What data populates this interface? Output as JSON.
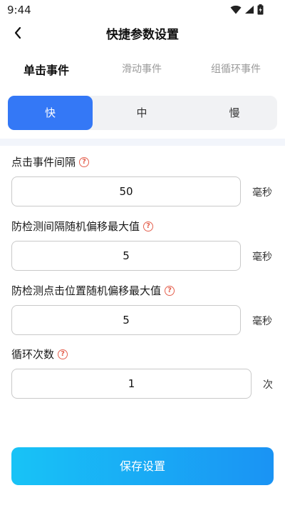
{
  "status_bar": {
    "time": "9:44"
  },
  "header": {
    "title": "快捷参数设置"
  },
  "event_tabs": [
    {
      "label": "单击事件",
      "active": true
    },
    {
      "label": "滑动事件",
      "active": false
    },
    {
      "label": "组循环事件",
      "active": false
    }
  ],
  "speed_modes": [
    {
      "label": "快",
      "active": true
    },
    {
      "label": "中",
      "active": false
    },
    {
      "label": "慢",
      "active": false
    }
  ],
  "fields": [
    {
      "label": "点击事件间隔",
      "value": "50",
      "unit": "毫秒"
    },
    {
      "label": "防检测间隔随机偏移最大值",
      "value": "5",
      "unit": "毫秒"
    },
    {
      "label": "防检测点击位置随机偏移最大值",
      "value": "5",
      "unit": "毫秒"
    },
    {
      "label": "循环次数",
      "value": "1",
      "unit": "次"
    }
  ],
  "help_icon_glyph": "?",
  "save_button": {
    "label": "保存设置"
  },
  "colors": {
    "accent": "#3478f6",
    "help": "#e4614f",
    "button_start": "#18c3f6",
    "button_end": "#1a93f4"
  }
}
